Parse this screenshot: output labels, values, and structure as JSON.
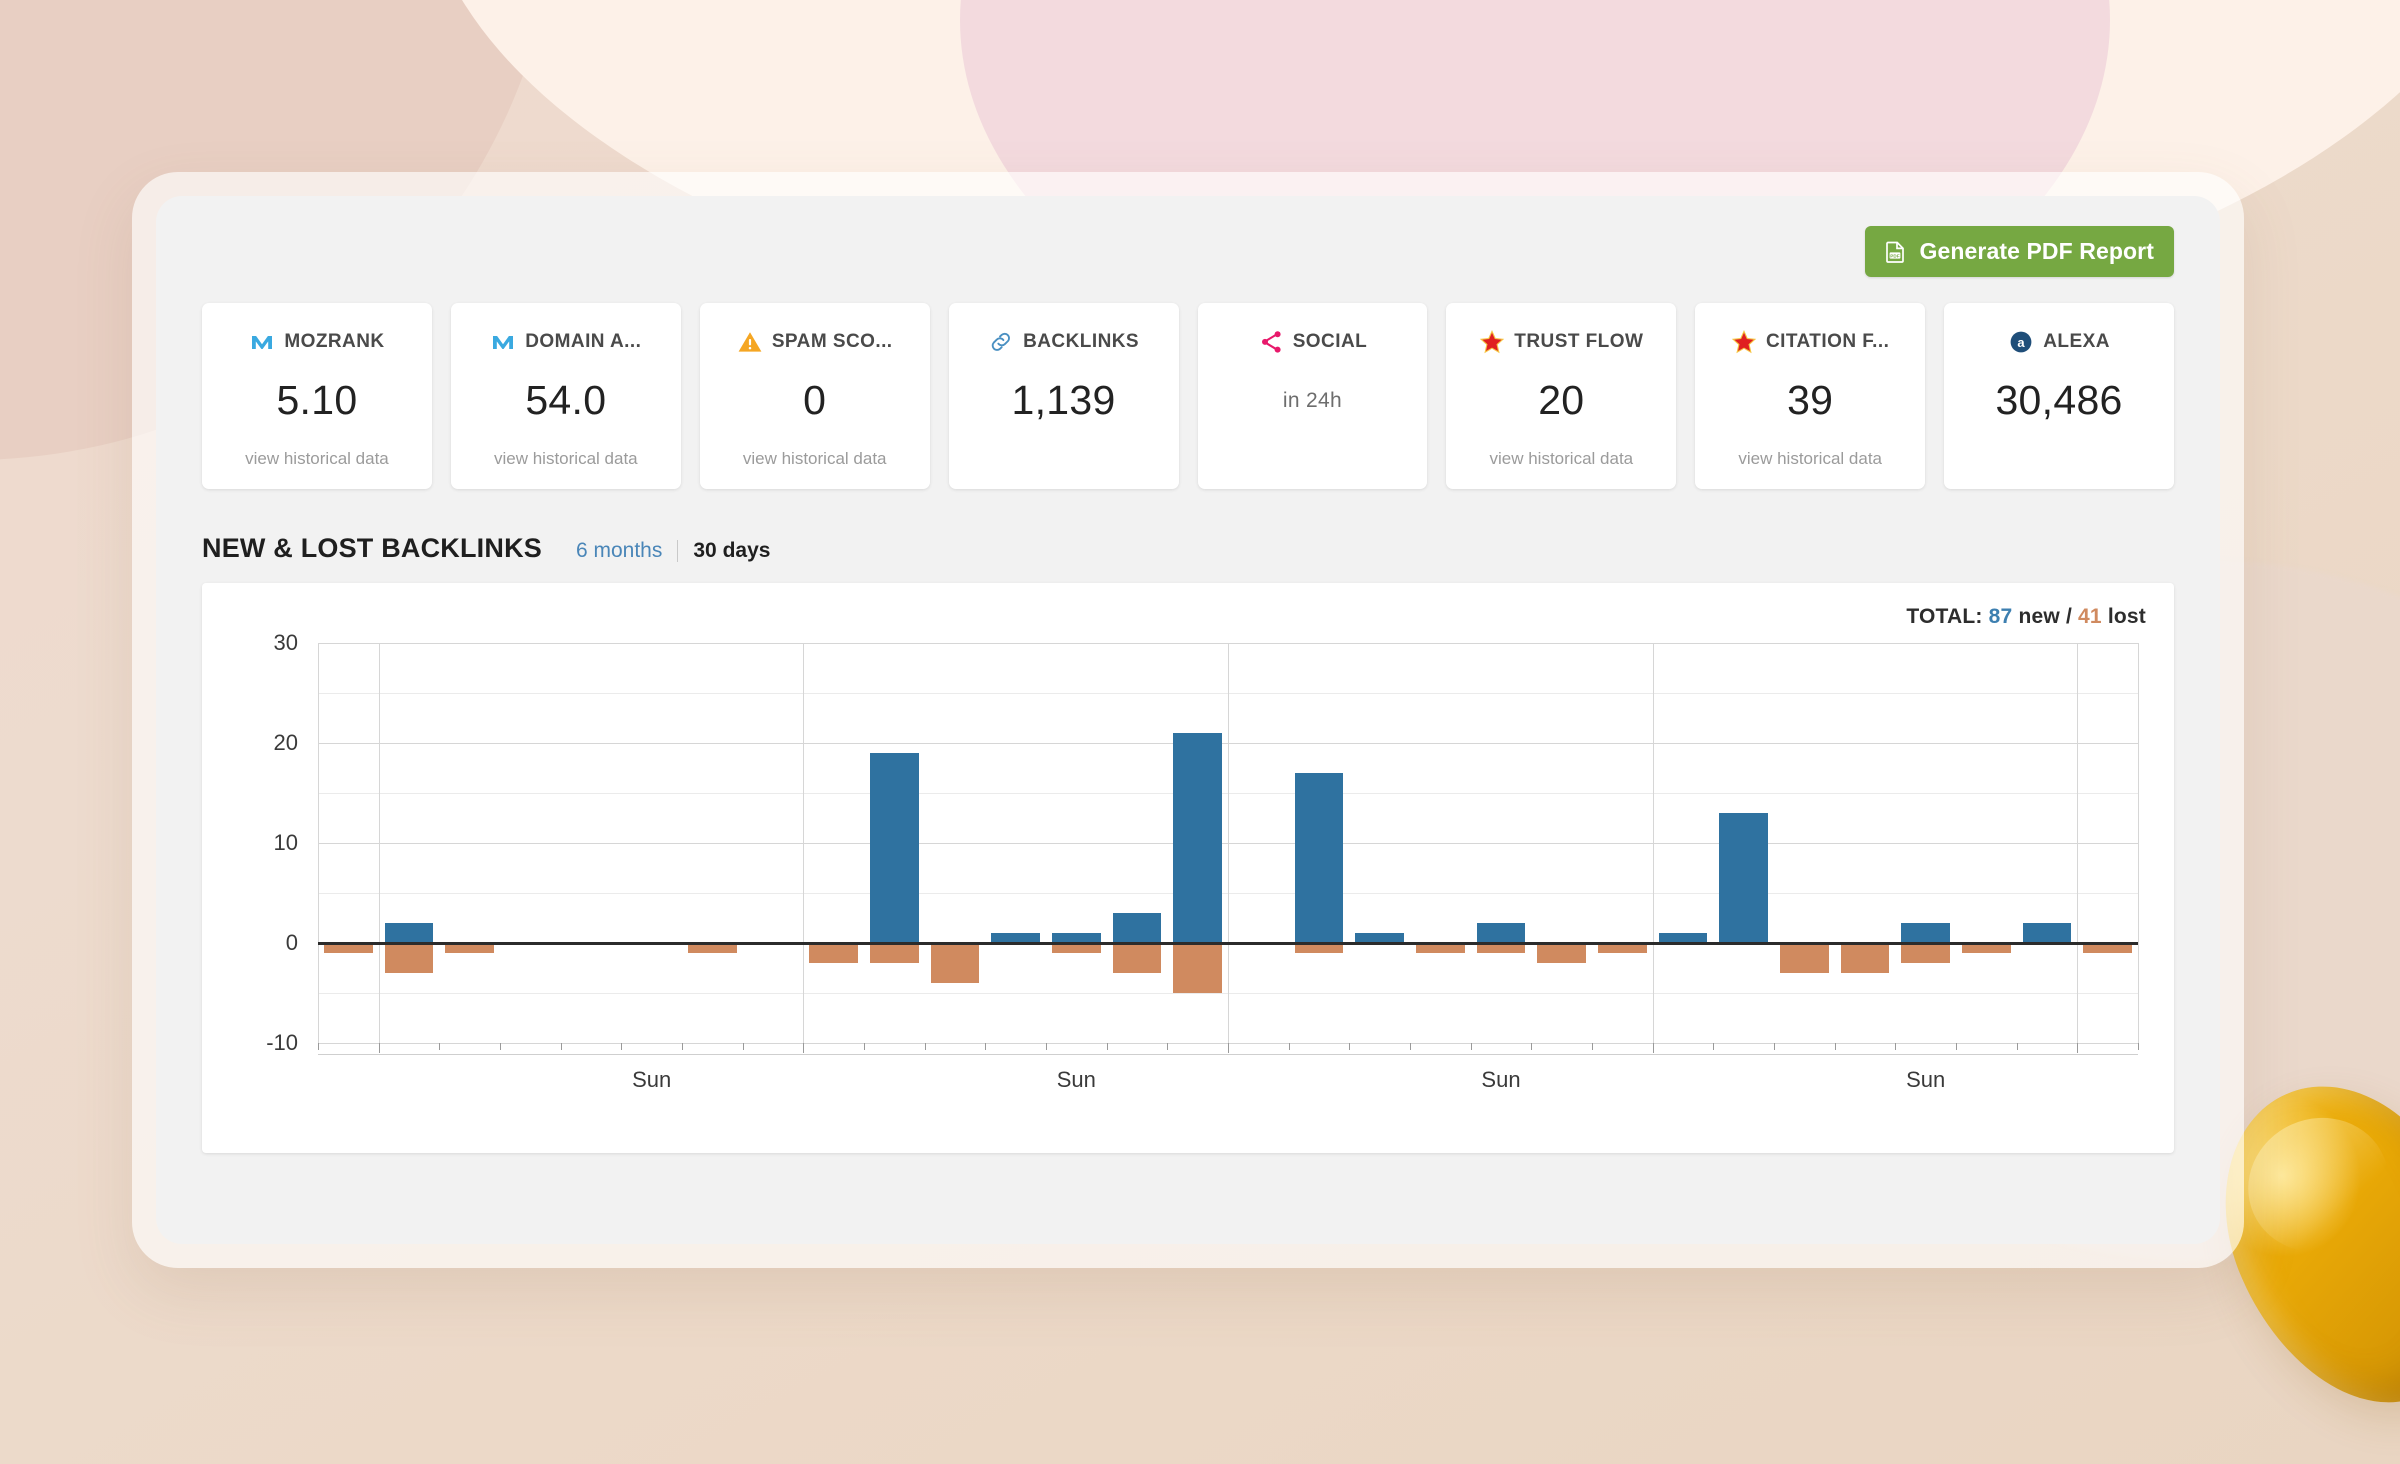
{
  "toolbar": {
    "pdf_button_label": "Generate PDF Report",
    "pdf_icon": "pdf-file-icon"
  },
  "metrics": [
    {
      "label": "MOZRANK",
      "value": "5.10",
      "link": "view historical data",
      "icon": "moz-logo-icon",
      "icon_color": "#3aa9e0",
      "has_link": true
    },
    {
      "label": "DOMAIN A...",
      "value": "54.0",
      "link": "view historical data",
      "icon": "moz-logo-icon",
      "icon_color": "#3aa9e0",
      "has_link": true
    },
    {
      "label": "SPAM SCO...",
      "value": "0",
      "link": "view historical data",
      "icon": "warning-triangle-icon",
      "icon_color": "#f5a623",
      "has_link": true
    },
    {
      "label": "BACKLINKS",
      "value": "1,139",
      "link": "",
      "icon": "link-chain-icon",
      "icon_color": "#4a90c2",
      "has_link": false
    },
    {
      "label": "SOCIAL",
      "value": "in 24h",
      "link": "",
      "icon": "share-nodes-icon",
      "icon_color": "#e8196b",
      "has_link": false,
      "value_is_sub": true
    },
    {
      "label": "TRUST FLOW",
      "value": "20",
      "link": "view historical data",
      "icon": "star-icon",
      "icon_color": "#e02020",
      "has_link": true
    },
    {
      "label": "CITATION F...",
      "value": "39",
      "link": "view historical data",
      "icon": "star-icon",
      "icon_color": "#e02020",
      "has_link": true
    },
    {
      "label": "ALEXA",
      "value": "30,486",
      "link": "",
      "icon": "alexa-logo-icon",
      "icon_color": "#1f4e79",
      "has_link": false
    }
  ],
  "section": {
    "title": "NEW & LOST BACKLINKS",
    "range_6_months": "6 months",
    "range_30_days": "30 days",
    "active_range": "30 days"
  },
  "chart_total": {
    "prefix": "TOTAL:",
    "new_count": "87",
    "new_word": "new",
    "separator": "/",
    "lost_count": "41",
    "lost_word": "lost"
  },
  "colors": {
    "new_bar": "#2f72a0",
    "lost_bar": "#d08a5f",
    "pdf_button": "#76a842",
    "link_blue": "#4a86b8"
  },
  "chart_data": {
    "type": "bar",
    "title": "NEW & LOST BACKLINKS",
    "subtitle": "TOTAL: 87 new / 41 lost",
    "xlabel": "",
    "ylabel": "",
    "ylim": [
      -10,
      30
    ],
    "yticks": [
      30,
      20,
      10,
      0,
      -10
    ],
    "ytick_labels": [
      "30",
      "20",
      "10",
      "0",
      "-10"
    ],
    "minor_yticks": [
      25,
      15,
      5,
      -5
    ],
    "grid": true,
    "legend_position": "top-right",
    "x_tick_labels": [
      "Sun",
      "Sun",
      "Sun",
      "Sun"
    ],
    "x_tick_label_indices": [
      5,
      12,
      19,
      26
    ],
    "n_days": 30,
    "series": [
      {
        "name": "new",
        "color": "#2f72a0",
        "values": [
          0,
          2,
          0,
          0,
          0,
          0,
          0,
          0,
          0,
          19,
          0,
          1,
          1,
          3,
          21,
          0,
          17,
          1,
          0,
          2,
          0,
          0,
          1,
          13,
          0,
          0,
          2,
          0,
          2,
          0
        ]
      },
      {
        "name": "lost",
        "color": "#d08a5f",
        "values": [
          1,
          3,
          1,
          0,
          0,
          0,
          1,
          0,
          2,
          2,
          4,
          0,
          1,
          3,
          5,
          0,
          1,
          0,
          1,
          1,
          2,
          1,
          0,
          0,
          3,
          3,
          2,
          1,
          0,
          1
        ]
      }
    ]
  }
}
